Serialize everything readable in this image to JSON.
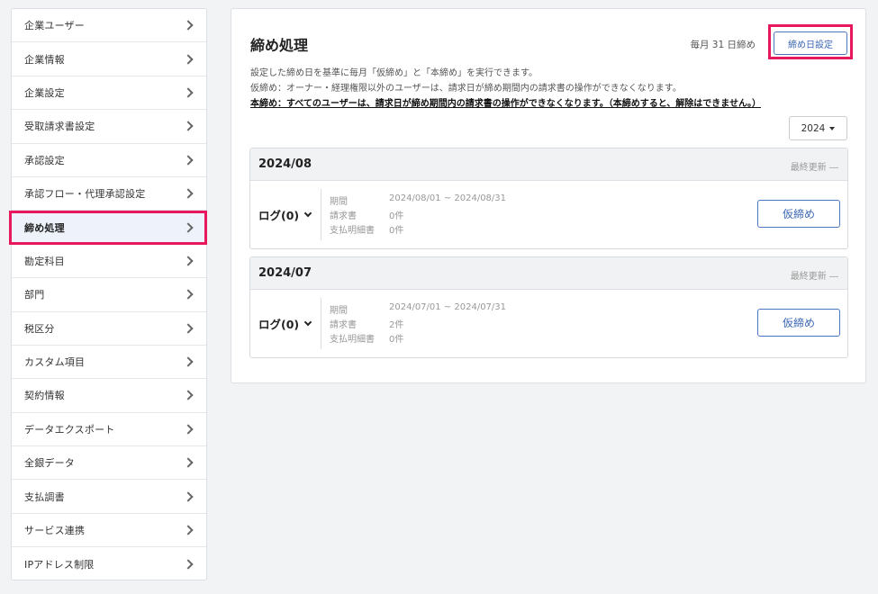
{
  "sidebar": {
    "items": [
      {
        "label": "企業ユーザー",
        "active": false
      },
      {
        "label": "企業情報",
        "active": false
      },
      {
        "label": "企業設定",
        "active": false
      },
      {
        "label": "受取請求書設定",
        "active": false
      },
      {
        "label": "承認設定",
        "active": false
      },
      {
        "label": "承認フロー・代理承認設定",
        "active": false
      },
      {
        "label": "締め処理",
        "active": true
      },
      {
        "label": "勘定科目",
        "active": false
      },
      {
        "label": "部門",
        "active": false
      },
      {
        "label": "税区分",
        "active": false
      },
      {
        "label": "カスタム項目",
        "active": false
      },
      {
        "label": "契約情報",
        "active": false
      },
      {
        "label": "データエクスポート",
        "active": false
      },
      {
        "label": "全銀データ",
        "active": false
      },
      {
        "label": "支払調書",
        "active": false
      },
      {
        "label": "サービス連携",
        "active": false
      },
      {
        "label": "IPアドレス制限",
        "active": false
      }
    ]
  },
  "main": {
    "title": "締め処理",
    "closing_day_text": "毎月 31 日締め",
    "closing_day_button": "締め日設定",
    "description_1": "設定した締め日を基準に毎月「仮締め」と「本締め」を実行できます。",
    "description_2": "仮締め：オーナー・経理権限以外のユーザーは、請求日が締め期間内の請求書の操作ができなくなります。",
    "description_3": "本締め：すべてのユーザーは、請求日が締め期間内の請求書の操作ができなくなります。（本締めすると、解除はできません。）",
    "year_select": "2024",
    "periods": [
      {
        "title": "2024/08",
        "last_updated": "最終更新 ―",
        "log_label": "ログ(0)",
        "period_key": "期間",
        "period_value": "2024/08/01 ~ 2024/08/31",
        "invoice_key": "請求書",
        "invoice_value": "0件",
        "payment_key": "支払明細書",
        "payment_value": "0件",
        "action_label": "仮締め"
      },
      {
        "title": "2024/07",
        "last_updated": "最終更新 ―",
        "log_label": "ログ(0)",
        "period_key": "期間",
        "period_value": "2024/07/01 ~ 2024/07/31",
        "invoice_key": "請求書",
        "invoice_value": "2件",
        "payment_key": "支払明細書",
        "payment_value": "0件",
        "action_label": "仮締め"
      }
    ]
  }
}
